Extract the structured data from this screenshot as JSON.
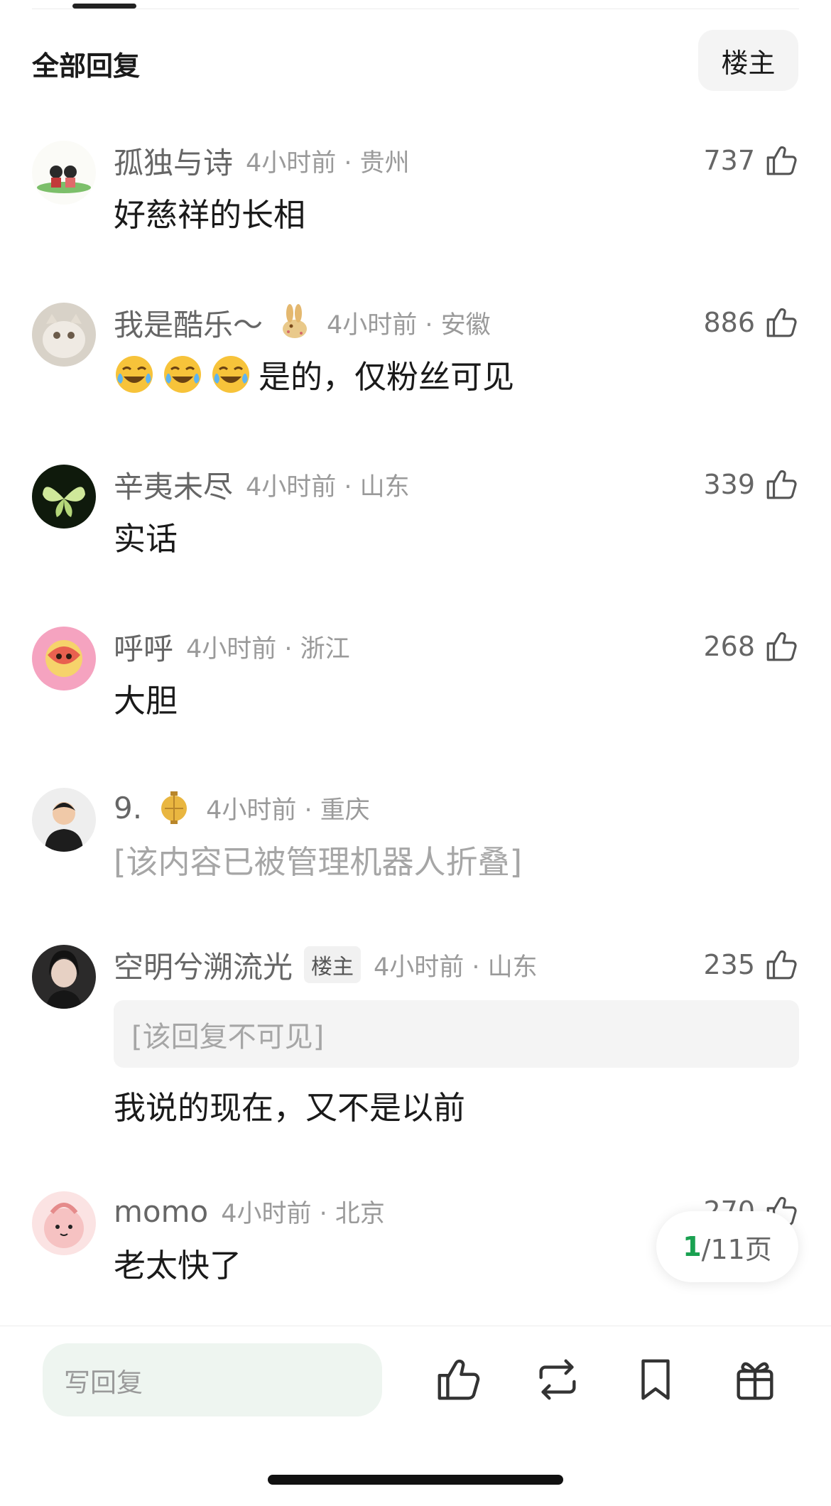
{
  "header": {
    "section_title": "全部回复",
    "owner_filter": "楼主"
  },
  "comments": [
    {
      "username": "孤独与诗",
      "time_location": "4小时前 · 贵州",
      "likes": "737",
      "text": "好慈祥的长相"
    },
    {
      "username": "我是酷乐～",
      "badge": "rabbit-badge",
      "time_location": "4小时前 · 安徽",
      "likes": "886",
      "emoji": "tears-of-joy",
      "text": "是的，仅粉丝可见"
    },
    {
      "username": "辛夷未尽",
      "time_location": "4小时前 · 山东",
      "likes": "339",
      "text": "实话"
    },
    {
      "username": "呼呼",
      "time_location": "4小时前 · 浙江",
      "likes": "268",
      "text": "大胆"
    },
    {
      "username": "9.",
      "badge": "lantern-badge",
      "time_location": "4小时前 · 重庆",
      "text": "[该内容已被管理机器人折叠]"
    },
    {
      "username": "空明兮溯流光",
      "owner_tag": "楼主",
      "time_location": "4小时前 · 山东",
      "likes": "235",
      "quoted": "[该回复不可见]",
      "text": "我说的现在，又不是以前"
    },
    {
      "username": "momo",
      "time_location": "4小时前 · 北京",
      "likes": "270",
      "text": "老太快了"
    }
  ],
  "pager": {
    "current": "1",
    "rest": "/11页"
  },
  "bottom_bar": {
    "reply_placeholder": "写回复",
    "icons": [
      "like-icon",
      "repost-icon",
      "bookmark-icon",
      "gift-icon"
    ]
  },
  "colors": {
    "accent": "#1aa151",
    "meta": "#9a9a9a",
    "username": "#666666"
  }
}
